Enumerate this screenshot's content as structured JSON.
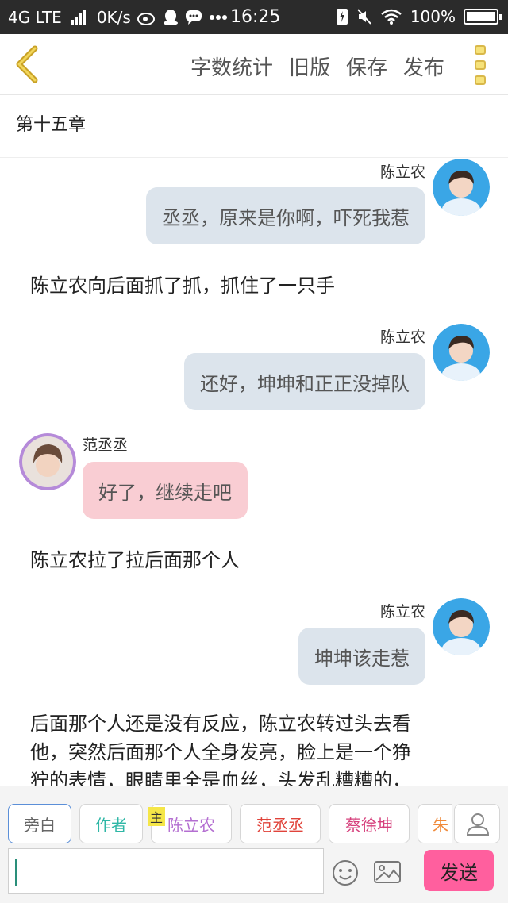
{
  "status_bar": {
    "network": "4G LTE",
    "speed": "0K/s",
    "time": "16:25",
    "battery": "100%",
    "battery_level": 1.0,
    "icons": [
      "signal-icon",
      "weibo-icon",
      "qq-icon",
      "chat-icon",
      "more-dots-icon",
      "flash-icon",
      "mute-icon",
      "wifi-icon",
      "battery-icon"
    ]
  },
  "header": {
    "back_icon": "back-chevron-icon",
    "menu": [
      "字数统计",
      "旧版",
      "保存",
      "发布"
    ],
    "more_icon": "more-vertical-icon"
  },
  "chapter_title": "第十五章",
  "chat": [
    {
      "type": "right",
      "name": "陈立农",
      "text": "丞丞，原来是你啊，吓死我惹"
    },
    {
      "type": "narration",
      "text": "陈立农向后面抓了抓，抓住了一只手"
    },
    {
      "type": "right",
      "name": "陈立农",
      "text": "还好，坤坤和正正没掉队"
    },
    {
      "type": "left",
      "name": "范丞丞",
      "text": "好了，继续走吧"
    },
    {
      "type": "narration",
      "text": "陈立农拉了拉后面那个人"
    },
    {
      "type": "right",
      "name": "陈立农",
      "text": "坤坤该走惹"
    },
    {
      "type": "narration",
      "lines": [
        "后面那个人还是没有反应，陈立农转过头去看",
        "他，突然后面那个人全身发亮，脸上是一个狰",
        "狞的表情，眼睛里全是血丝，头发乱糟糟的，"
      ]
    }
  ],
  "composer": {
    "roles": [
      {
        "label": "旁白",
        "color": "#666666"
      },
      {
        "label": "作者",
        "color": "#2fb7a6"
      },
      {
        "label": "陈立农",
        "color": "#b46fd1"
      },
      {
        "label": "范丞丞",
        "color": "#e0433a"
      },
      {
        "label": "蔡徐坤",
        "color": "#d6407c"
      },
      {
        "label": "朱",
        "color": "#f08a3a"
      }
    ],
    "main_tag": "主",
    "input_value": "",
    "send_label": "发送",
    "accent": "#ff5f9e"
  }
}
